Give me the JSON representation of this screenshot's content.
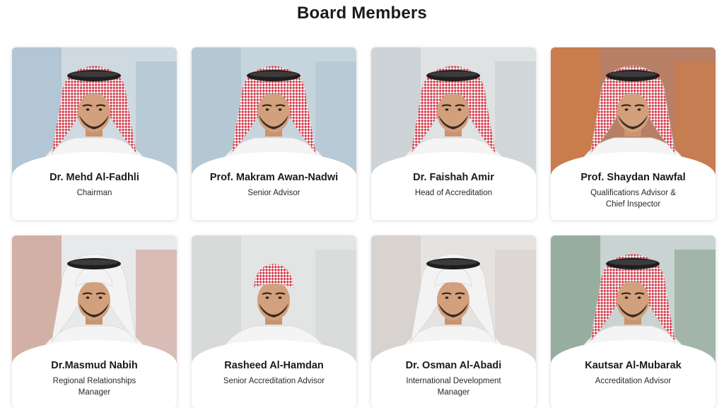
{
  "page": {
    "title": "Board Members"
  },
  "members": [
    {
      "name": "Dr. Mehd Al-Fadhli",
      "role": "Chairman",
      "bg": "#cfd9e1",
      "accent": "#8fb0c7",
      "scarf": "red"
    },
    {
      "name": "Prof. Makram Awan-Nadwi",
      "role": "Senior Advisor",
      "bg": "#c6d5dd",
      "accent": "#9bb7c6",
      "scarf": "red"
    },
    {
      "name": "Dr. Faishah Amir",
      "role": "Head of Accreditation",
      "bg": "#dfe2e3",
      "accent": "#b8c2c6",
      "scarf": "red"
    },
    {
      "name": "Prof. Shaydan Nawfal",
      "role": "Qualifications Advisor & Chief Inspector",
      "bg": "#b77f66",
      "accent": "#e07a2c",
      "scarf": "red"
    },
    {
      "name": "Dr.Masmud Nabih",
      "role": "Regional Relationships Manager",
      "bg": "#e8e9ea",
      "accent": "#b96b52",
      "scarf": "white"
    },
    {
      "name": "Rasheed Al-Hamdan",
      "role": "Senior Accreditation Advisor",
      "bg": "#e3e4e4",
      "accent": "#c9cccc",
      "scarf": "redwrap"
    },
    {
      "name": "Dr. Osman Al-Abadi",
      "role": "International Development Manager",
      "bg": "#e6e2df",
      "accent": "#c9c2bf",
      "scarf": "white"
    },
    {
      "name": "Kautsar Al-Mubarak",
      "role": "Accreditation Advisor",
      "bg": "#c9d3d2",
      "accent": "#5b7f63",
      "scarf": "red"
    }
  ]
}
